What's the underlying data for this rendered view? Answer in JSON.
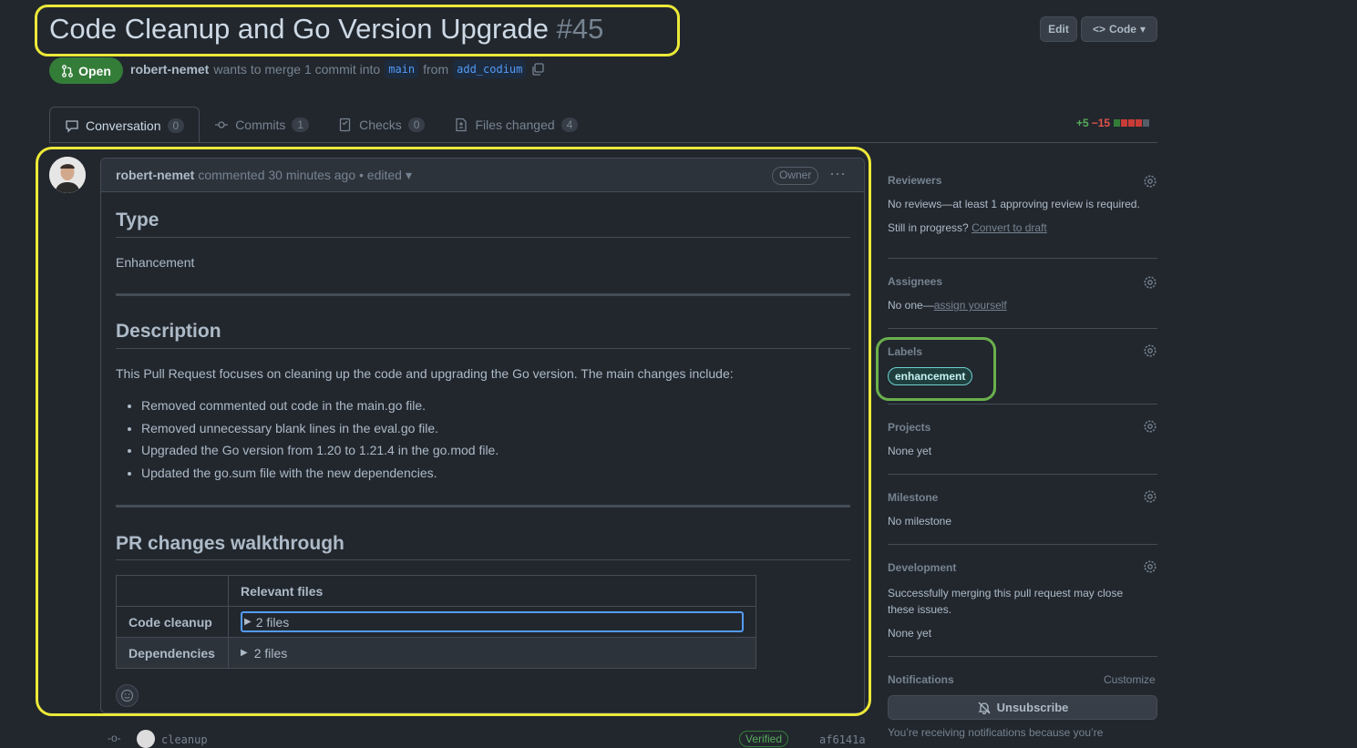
{
  "header": {
    "title": "Code Cleanup and Go Version Upgrade",
    "number": "#45",
    "edit_label": "Edit",
    "code_label": "Code",
    "state": "Open",
    "author": "robert-nemet",
    "merge_text": "wants to merge 1 commit into",
    "base_branch": "main",
    "from_text": "from",
    "head_branch": "add_codium"
  },
  "tabs": [
    {
      "label": "Conversation",
      "count": "0"
    },
    {
      "label": "Commits",
      "count": "1"
    },
    {
      "label": "Checks",
      "count": "0"
    },
    {
      "label": "Files changed",
      "count": "4"
    }
  ],
  "diffstat": {
    "additions": "+5",
    "deletions": "−15"
  },
  "comment": {
    "author": "robert-nemet",
    "meta": "commented 30 minutes ago • edited",
    "role": "Owner",
    "type_heading": "Type",
    "type_value": "Enhancement",
    "description_heading": "Description",
    "description_text": "This Pull Request focuses on cleaning up the code and upgrading the Go version. The main changes include:",
    "bullets": [
      "Removed commented out code in the main.go file.",
      "Removed unnecessary blank lines in the eval.go file.",
      "Upgraded the Go version from 1.20 to 1.21.4 in the go.mod file.",
      "Updated the go.sum file with the new dependencies."
    ],
    "walkthrough_heading": "PR changes walkthrough",
    "table": {
      "header": "Relevant files",
      "rows": [
        {
          "key": "Code cleanup",
          "value": "2 files"
        },
        {
          "key": "Dependencies",
          "value": "2 files"
        }
      ]
    }
  },
  "timeline": {
    "message": "cleanup",
    "verified": "Verified",
    "sha": "af6141a"
  },
  "sidebar": {
    "reviewers": {
      "title": "Reviewers",
      "text": "No reviews—at least 1 approving review is required.",
      "progress_text": "Still in progress?",
      "convert_link": "Convert to draft"
    },
    "assignees": {
      "title": "Assignees",
      "text": "No one—",
      "link": "assign yourself"
    },
    "labels": {
      "title": "Labels",
      "items": [
        "enhancement"
      ]
    },
    "projects": {
      "title": "Projects",
      "text": "None yet"
    },
    "milestone": {
      "title": "Milestone",
      "text": "No milestone"
    },
    "development": {
      "title": "Development",
      "text": "Successfully merging this pull request may close these issues.",
      "value": "None yet"
    },
    "notifications": {
      "title": "Notifications",
      "customize": "Customize",
      "unsubscribe": "Unsubscribe",
      "reason": "You’re receiving notifications because you’re"
    }
  },
  "colors": {
    "accent": "#539bf5",
    "open": "#347d39",
    "highlight_yellow": "#ece938",
    "highlight_green": "#6ab04c"
  }
}
